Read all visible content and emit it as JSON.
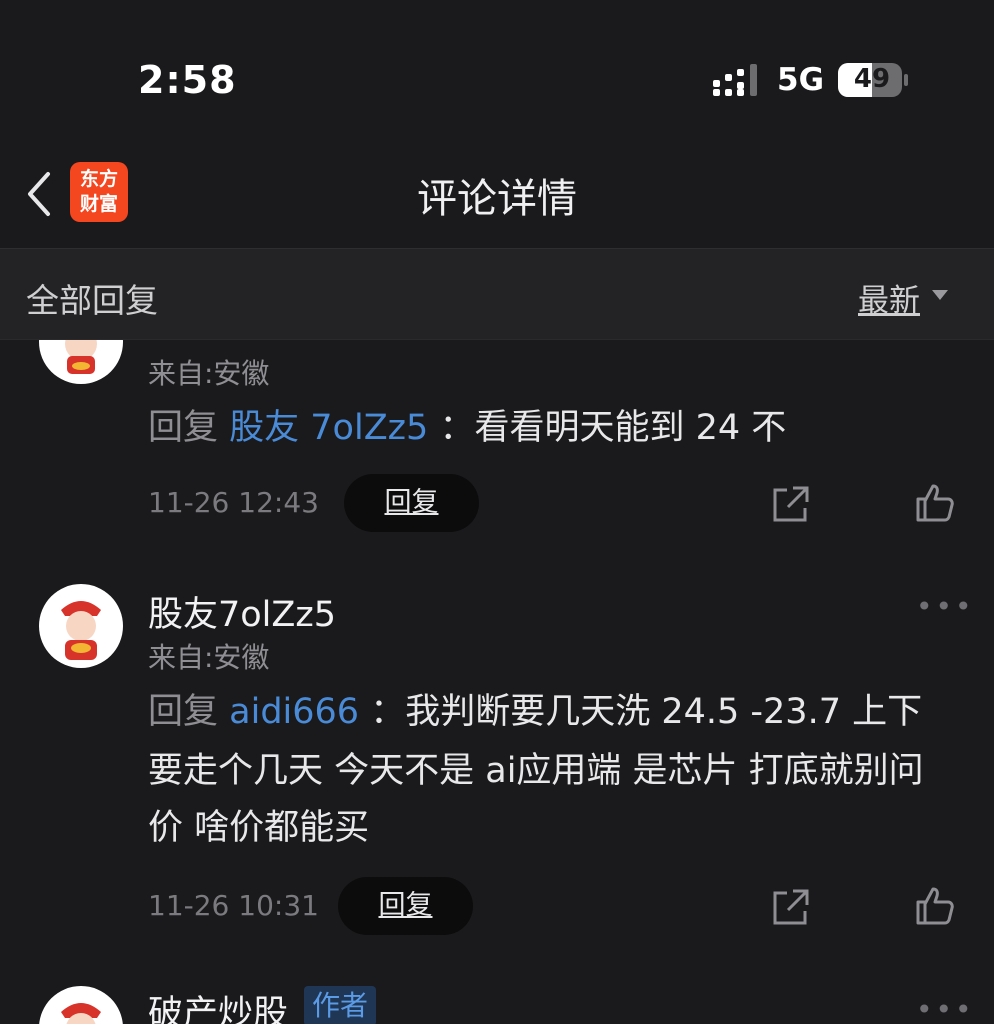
{
  "status_bar": {
    "time": "2:58",
    "network": "5G",
    "battery": "49"
  },
  "header": {
    "back_icon": "chevron-left-icon",
    "logo_line1": "东方",
    "logo_line2": "财富",
    "title": "评论详情"
  },
  "subheader": {
    "all_replies": "全部回复",
    "sort_label": "最新"
  },
  "comments": [
    {
      "from": "来自:安徽",
      "reply_prefix": "回复",
      "reply_target": "股友 7olZz5",
      "reply_text": "：看看明天能到 24 不",
      "timestamp": "11-26 12:43",
      "reply_button": "回复"
    },
    {
      "username": "股友7olZz5",
      "from": "来自:安徽",
      "reply_prefix": "回复",
      "reply_target": "aidi666",
      "reply_text": "：我判断要几天洗 24.5 -23.7 上下",
      "reply_text_line2": "要走个几天 今天不是 ai应用端 是芯片 打底就别问",
      "reply_text_line3": "价 啥价都能买",
      "timestamp": "11-26 10:31",
      "reply_button": "回复",
      "more": "•••"
    },
    {
      "username": "破产炒股",
      "badge": "作者",
      "more": "•••"
    }
  ],
  "icons": {
    "share": "share-icon",
    "like": "thumbs-up-icon"
  },
  "colors": {
    "background": "#1a1a1c",
    "link": "#4a8bd8",
    "brand": "#f5471f"
  }
}
